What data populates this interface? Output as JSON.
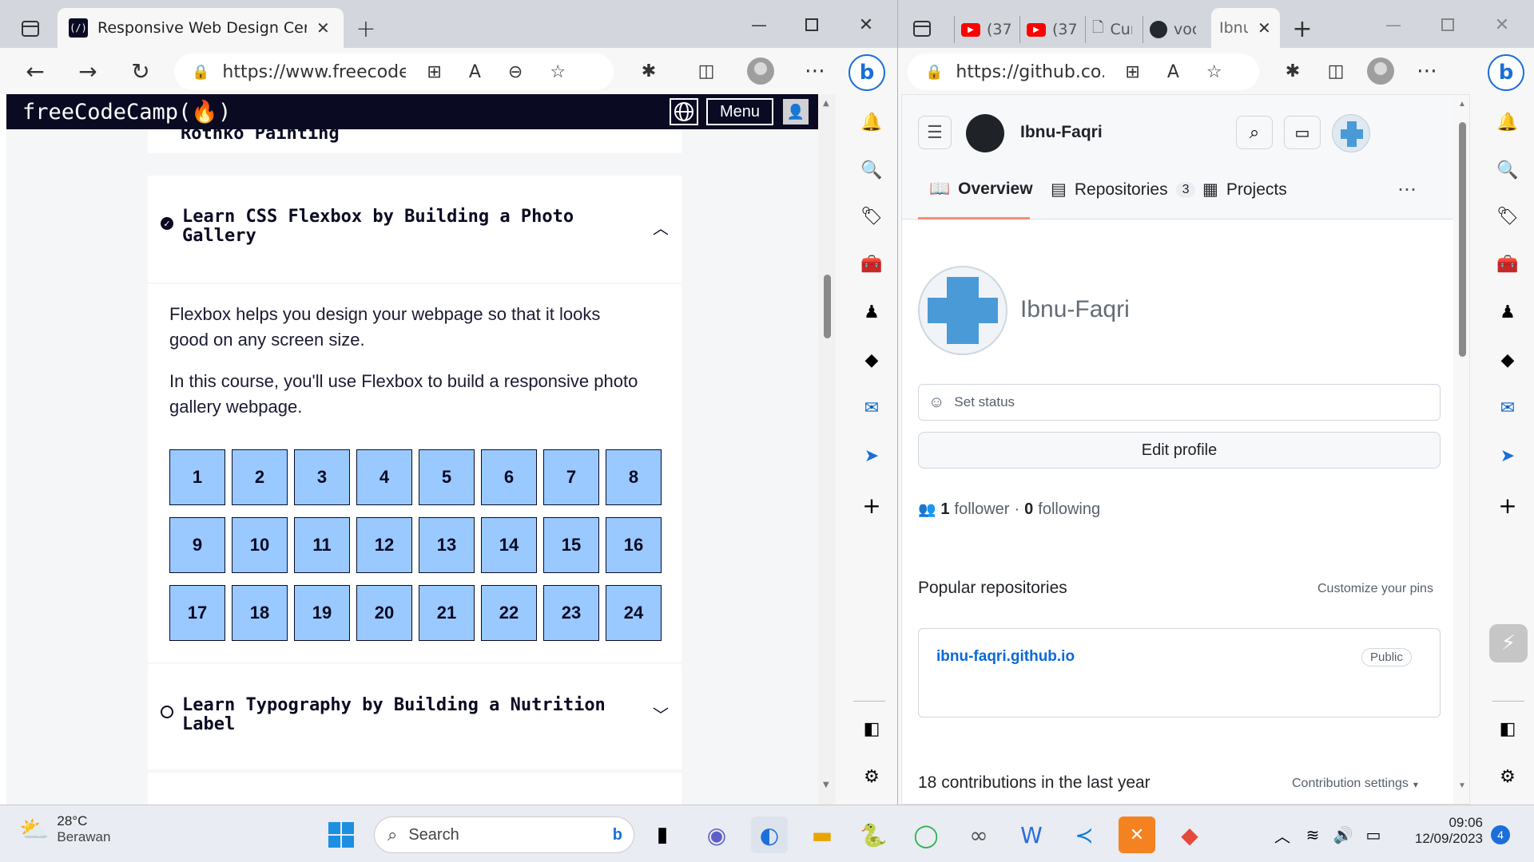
{
  "left_window": {
    "tab_title": "Responsive Web Design Certifica",
    "address": "https://www.freecodec...",
    "fcc": {
      "logo": "freeCodeCamp(🔥)",
      "menu_label": "Menu",
      "prev_block_title": "Rothko Painting",
      "block1_title_line1": "Learn CSS Flexbox by Building a Photo",
      "block1_title_line2": "Gallery",
      "desc1_line1": "Flexbox helps you design your webpage so that it looks",
      "desc1_line2": "good on any screen size.",
      "desc2_line1": "In this course, you'll use Flexbox to build a responsive photo",
      "desc2_line2": "gallery webpage.",
      "steps": [
        "1",
        "2",
        "3",
        "4",
        "5",
        "6",
        "7",
        "8",
        "9",
        "10",
        "11",
        "12",
        "13",
        "14",
        "15",
        "16",
        "17",
        "18",
        "19",
        "20",
        "21",
        "22",
        "23",
        "24"
      ],
      "block2_title_line1": "Learn Typography by Building a Nutrition",
      "block2_title_line2": "Label"
    }
  },
  "right_window": {
    "tabs": [
      "(37",
      "(37",
      "Cur",
      "voc",
      "Ibnu"
    ],
    "address": "https://github.co...",
    "gh": {
      "header_user": "Ibnu-Faqri",
      "nav_overview": "Overview",
      "nav_repositories": "Repositories",
      "repo_count": "3",
      "nav_projects": "Projects",
      "profile_name": "Ibnu-Faqri",
      "set_status": "Set status",
      "edit_profile": "Edit profile",
      "followers_count": "1",
      "followers_label": "follower",
      "separator": "·",
      "following_count": "0",
      "following_label": "following",
      "popular_repos": "Popular repositories",
      "customize_pins": "Customize your pins",
      "repo_name": "ibnu-faqri.github.io",
      "repo_visibility": "Public",
      "contributions": "18 contributions in the last year",
      "contribution_settings": "Contribution settings"
    }
  },
  "taskbar": {
    "weather_temp": "28°C",
    "weather_desc": "Berawan",
    "search_placeholder": "Search",
    "time": "09:06",
    "date": "12/09/2023",
    "notification_count": "4"
  },
  "colors": {
    "fcc_nav": "#0a0a23",
    "fcc_cell": "#99c9ff",
    "gh_link": "#0969da",
    "gh_accent": "#fd8c73"
  }
}
